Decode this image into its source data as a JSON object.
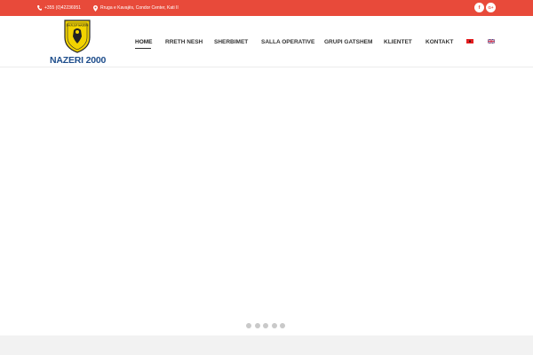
{
  "topbar": {
    "phone": "+355 (0)42236951",
    "address": "Rruga e Kavajës, Condor Center, Kati II",
    "social": [
      "f",
      "G+"
    ],
    "background_color": "#e84a3a"
  },
  "logo": {
    "crest_text": "SH.R.S.P NAZERI",
    "name": "NAZERI 2000"
  },
  "nav": {
    "items": [
      {
        "label": "HOME",
        "active": true
      },
      {
        "label": "RRETH NESH"
      },
      {
        "label": "SHERBIMET"
      },
      {
        "label": "SALLA OPERATIVE"
      },
      {
        "label": "GRUPI GATSHEM"
      },
      {
        "label": "KLIENTET"
      },
      {
        "label": "KONTAKT"
      }
    ],
    "languages": [
      "albania-flag-icon",
      "uk-flag-icon"
    ]
  },
  "slider": {
    "dot_count": 5
  }
}
